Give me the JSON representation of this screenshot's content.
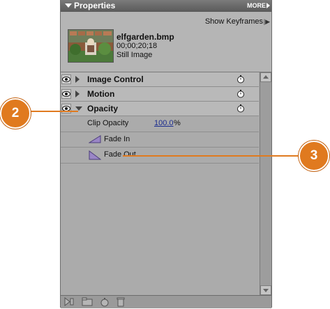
{
  "panel": {
    "title": "Properties",
    "more_label": "MORE"
  },
  "header": {
    "show_keyframes_label": "Show Keyframes",
    "clip_name": "elfgarden.bmp",
    "clip_timecode": "00;00;20;18",
    "clip_type": "Still Image"
  },
  "effects": [
    {
      "label": "Image Control",
      "expanded": false
    },
    {
      "label": "Motion",
      "expanded": false
    },
    {
      "label": "Opacity",
      "expanded": true
    }
  ],
  "opacity_param": {
    "label": "Clip Opacity",
    "value": "100.0",
    "unit": "%"
  },
  "presets": [
    {
      "label": "Fade In",
      "icon": "fade-in-icon"
    },
    {
      "label": "Fade Out",
      "icon": "fade-out-icon"
    }
  ],
  "callouts": {
    "step_2": "2",
    "step_3": "3"
  },
  "colors": {
    "callout": "#e07a1f",
    "panel_bg": "#ababab",
    "value_link": "#1a2c8f"
  },
  "bottom_icons": [
    "play-forward-icon",
    "new-folder-icon",
    "stopwatch-icon",
    "trash-icon"
  ]
}
